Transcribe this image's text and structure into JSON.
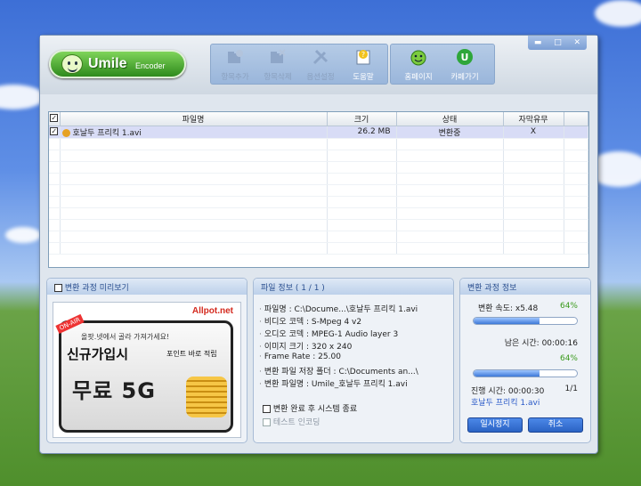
{
  "app": {
    "logo_name": "Umile",
    "logo_sub": "Encoder"
  },
  "window_controls": {
    "minimize": "▬",
    "maximize": "□",
    "close": "✕"
  },
  "toolbar": {
    "items": [
      {
        "label": "항목추가",
        "icon": "folder-add-icon",
        "enabled": false
      },
      {
        "label": "항목삭제",
        "icon": "folder-delete-icon",
        "enabled": false
      },
      {
        "label": "옵션설정",
        "icon": "tools-icon",
        "enabled": false
      },
      {
        "label": "도움말",
        "icon": "help-icon",
        "enabled": true
      },
      {
        "label": "홈페이지",
        "icon": "smiley-home-icon",
        "enabled": true
      },
      {
        "label": "카페가기",
        "icon": "cafe-u-icon",
        "enabled": true
      }
    ]
  },
  "file_list": {
    "headers": {
      "name": "파일명",
      "size": "크기",
      "status": "상태",
      "subtitle": "자막유무"
    },
    "rows": [
      {
        "name": "호날두 프리킥 1.avi",
        "size": "26.2 MB",
        "status": "변환중",
        "subtitle": "X"
      }
    ]
  },
  "preview_panel": {
    "title": "변환 과정 미리보기",
    "ad": {
      "brand": "Allpot.net",
      "badge": "ON-AIR",
      "line1": "올팟.넷에서 골라 가져가세요!",
      "line2": "신규가입시",
      "line2_small": "포인트 바로 적립",
      "line3": "무료 5G"
    }
  },
  "file_info": {
    "title": "파일 정보 ( 1 / 1 )",
    "lines": [
      "파일명 : C:\\Docume...\\호날두 프리킥 1.avi",
      "비디오 코덱 : S-Mpeg 4 v2",
      "오디오 코덱 : MPEG-1 Audio layer 3",
      "이미지 크기 : 320 x 240",
      "Frame Rate : 25.00",
      "변환 파일 저장 폴더 : C:\\Documents an...\\",
      "변환 파일명 : Umile_호날두 프리킥 1.avi"
    ],
    "options": [
      {
        "label": "변환 완료 후 시스템 종료",
        "checked": false,
        "enabled": true
      },
      {
        "label": "테스트 인코딩",
        "checked": false,
        "enabled": false
      }
    ]
  },
  "progress": {
    "title": "변환 과정 정보",
    "speed": "변환 속도: x5.48",
    "percent1": "64%",
    "fill1": 0.64,
    "remaining": "남은 시간: 00:00:16",
    "percent2": "64%",
    "fill2": 0.64,
    "elapsed": "진행 시간: 00:00:30",
    "count": "1/1",
    "current_file": "호날두 프리킥 1.avi",
    "pause_label": "일시정지",
    "cancel_label": "취소"
  },
  "colors": {
    "accent": "#2b63c4",
    "percent_green": "#3a9a1c",
    "selected_row": "#d8dcf6"
  }
}
